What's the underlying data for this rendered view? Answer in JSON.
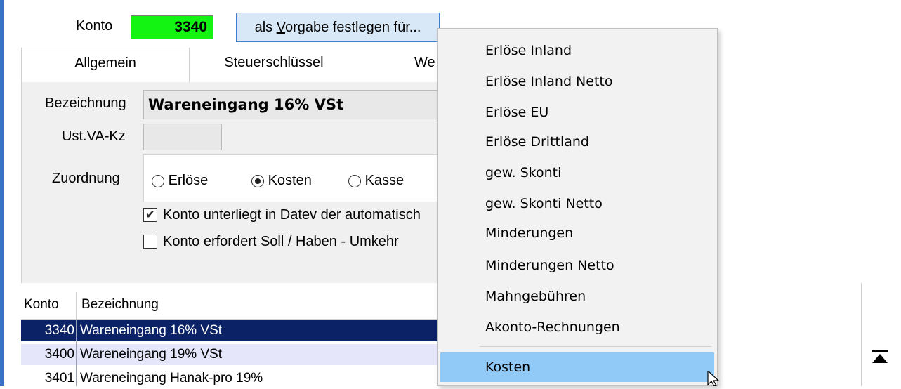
{
  "header": {
    "konto_label": "Konto",
    "konto_value": "3340",
    "vorgabe_prefix": "als ",
    "vorgabe_underline": "V",
    "vorgabe_rest": "orgabe festlegen für..."
  },
  "tabs": [
    {
      "label": "Allgemein",
      "active": true
    },
    {
      "label": "Steuerschlüssel",
      "active": false
    },
    {
      "label": "We",
      "active": false
    }
  ],
  "form": {
    "bezeichnung_label": "Bezeichnung",
    "bezeichnung_value": "Wareneingang 16% VSt",
    "ust_label": "Ust.VA-Kz",
    "ust_value": "",
    "zuordnung_label": "Zuordnung",
    "radio_erloese": "Erlöse",
    "radio_kosten": "Kosten",
    "radio_kasse": "Kasse",
    "radio_selected": "Kosten",
    "check1_label": "Konto unterliegt in Datev der automatisch",
    "check1_checked": true,
    "check2_label": "Konto erfordert Soll / Haben - Umkehr",
    "check2_checked": false
  },
  "table": {
    "columns": [
      "Konto",
      "Bezeichnung"
    ],
    "rows": [
      {
        "konto": "3340",
        "bezeichnung": "Wareneingang 16% VSt",
        "selected": true
      },
      {
        "konto": "3400",
        "bezeichnung": "Wareneingang 19% VSt",
        "selected": false
      },
      {
        "konto": "3401",
        "bezeichnung": "Wareneingang Hanak-pro 19%",
        "selected": false
      }
    ]
  },
  "menu": {
    "items": [
      "Erlöse Inland",
      "Erlöse Inland Netto",
      "Erlöse EU",
      "Erlöse Drittland",
      "gew. Skonti",
      "gew. Skonti Netto",
      "Minderungen",
      "Minderungen Netto",
      "Mahngebühren",
      "Akonto-Rechnungen"
    ],
    "highlighted_item": "Kosten"
  },
  "icons": {
    "scroll_top": "scroll-to-top-icon",
    "cursor": "mouse-pointer-icon"
  },
  "colors": {
    "konto_bg": "#13f413",
    "selection": "#0b2366",
    "menu_highlight": "#91c9f7",
    "button_bg": "#d9e8f7"
  }
}
